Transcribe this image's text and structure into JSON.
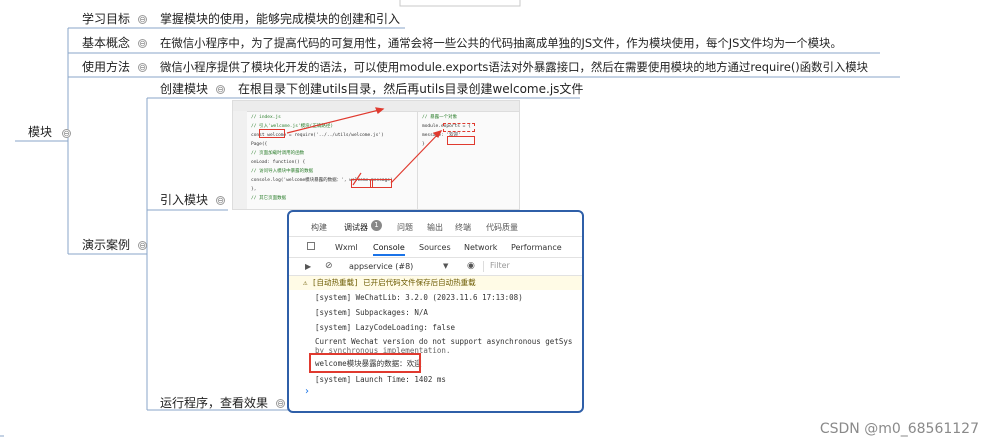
{
  "mindmap": {
    "root": "模块",
    "branches": [
      {
        "label": "学习目标",
        "note": "掌握模块的使用，能够完成模块的创建和引入"
      },
      {
        "label": "基本概念",
        "note": "在微信小程序中，为了提高代码的可复用性，通常会将一些公共的代码抽离成单独的JS文件，作为模块使用，每个JS文件均为一个模块。"
      },
      {
        "label": "使用方法",
        "note": "微信小程序提供了模块化开发的语法，可以使用module.exports语法对外暴露接口，然后在需要使用模块的地方通过require()函数引入模块"
      },
      {
        "label": "演示案例"
      }
    ],
    "demo_children": [
      {
        "label": "创建模块",
        "note": "在根目录下创建utils目录，然后再utils目录创建welcome.js文件"
      },
      {
        "label": "引入模块"
      },
      {
        "label": "运行程序，查看效果"
      }
    ],
    "collapse_glyph": "⊖"
  },
  "code_shot": {
    "left_lines": [
      "// index.js",
      "// 引入'welcome.js'模块(正确路径)",
      "const welcome = require('../../utils/welcome.js')",
      "Page({",
      "  // 页面加载时调用的函数",
      "  onLoad: function() {",
      "    // 访问导入模块中暴露的数据",
      "    console.log('welcome模块暴露的数据：', welcome.message)",
      "  },",
      "  // 其它页面数据"
    ],
    "right_lines": [
      "// 暴露一个对象",
      "module.exports = {",
      "  message: '欢迎'",
      "}"
    ]
  },
  "console": {
    "top_tabs": [
      "构建",
      "调试器",
      "问题",
      "输出",
      "终端",
      "代码质量"
    ],
    "badge": "1",
    "dev_tabs": [
      "Wxml",
      "Console",
      "Sources",
      "Network",
      "Performance"
    ],
    "context": "appservice (#8)",
    "filter_placeholder": "Filter",
    "lines": [
      "⚠ [自动热重载] 已开启代码文件保存后自动热重载",
      "[system] WeChatLib: 3.2.0 (2023.11.6 17:13:08)",
      "[system] Subpackages: N/A",
      "[system] LazyCodeLoading: false",
      "Current Wechat version do not support asynchronous getSys",
      "by synchronous implementation.",
      "welcome模块暴露的数据：欢迎",
      "[system] Launch Time: 1402 ms"
    ],
    "prompt": "›"
  },
  "watermark": "CSDN @m0_68561127"
}
